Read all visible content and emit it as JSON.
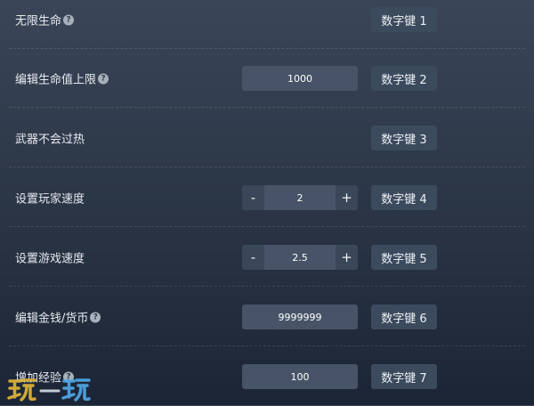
{
  "rows": [
    {
      "label": "无限生命",
      "key": "数字键 1"
    },
    {
      "label": "编辑生命值上限",
      "value": "1000",
      "key": "数字键 2"
    },
    {
      "label": "武器不会过热",
      "key": "数字键 3"
    },
    {
      "label": "设置玩家速度",
      "minus": "-",
      "value": "2",
      "plus": "+",
      "key": "数字键 4"
    },
    {
      "label": "设置游戏速度",
      "minus": "-",
      "value": "2.5",
      "plus": "+",
      "key": "数字键 5"
    },
    {
      "label": "编辑金钱/货币",
      "value": "9999999",
      "key": "数字键 6"
    },
    {
      "label": "增加经验",
      "value": "100",
      "key": "数字键 7"
    }
  ],
  "help_glyph": "?",
  "watermark": "玩一玩",
  "colors": {
    "watermark_left": "#d8b13a",
    "watermark_right": "#4fa3e0"
  }
}
